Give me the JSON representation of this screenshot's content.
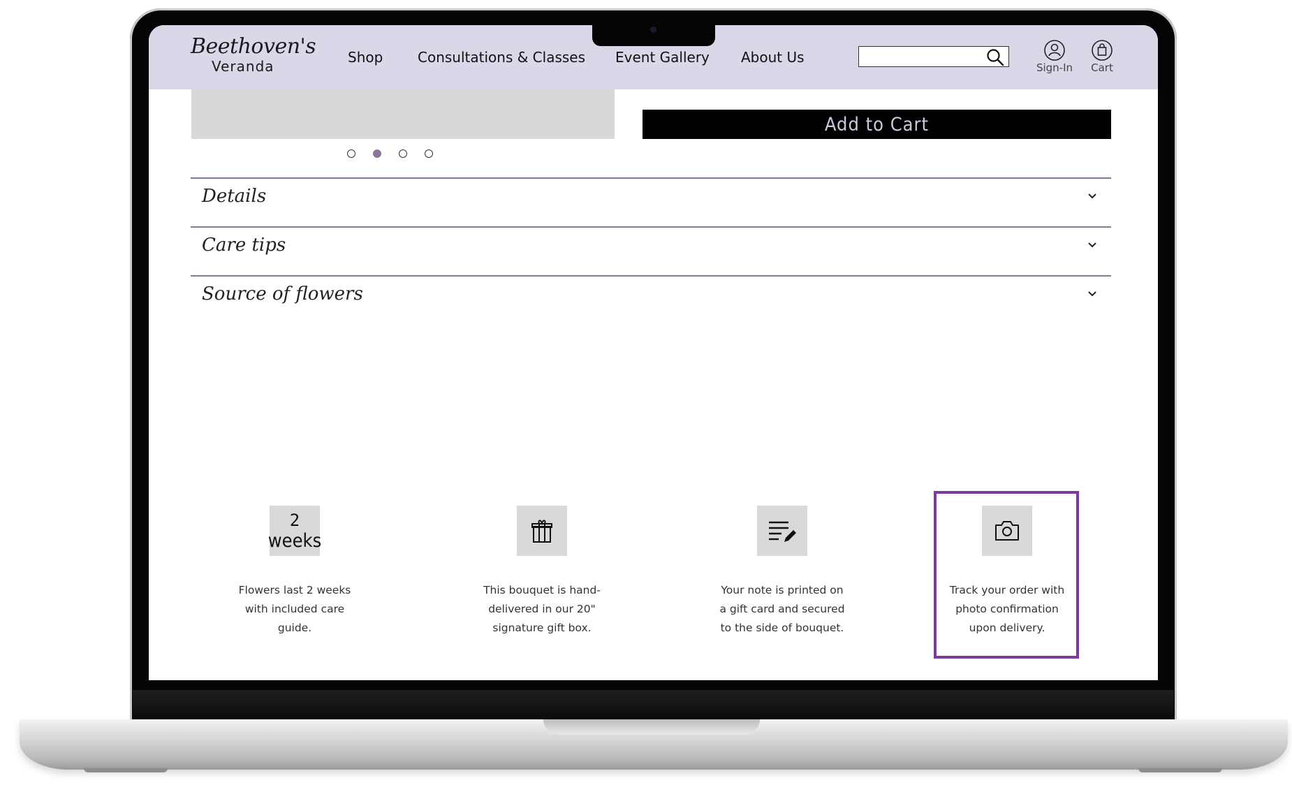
{
  "brand": {
    "logo_script": "Beethoven's",
    "logo_sub": "Veranda"
  },
  "nav": {
    "items": [
      "Shop",
      "Consultations & Classes",
      "Event Gallery",
      "About Us"
    ]
  },
  "search": {
    "value": "",
    "placeholder": ""
  },
  "account": {
    "signin_label": "Sign-In",
    "cart_label": "Cart"
  },
  "carousel": {
    "dot_count": 4,
    "active_index": 1
  },
  "product": {
    "add_to_cart_label": "Add to Cart"
  },
  "accordion": {
    "items": [
      "Details",
      "Care tips",
      "Source of flowers"
    ]
  },
  "features": [
    {
      "icon": "two-weeks-badge",
      "tile_num": "2",
      "tile_text": "weeks",
      "lines": [
        "Flowers last 2 weeks",
        "with included care",
        "guide."
      ]
    },
    {
      "icon": "gift-box-icon",
      "lines": [
        "This bouquet is hand-",
        "delivered in our 20\"",
        "signature gift box."
      ]
    },
    {
      "icon": "note-edit-icon",
      "lines": [
        "Your note is printed on",
        "a gift card and secured",
        "to the side of  bouquet."
      ]
    },
    {
      "icon": "camera-icon",
      "lines": [
        "Track your order with",
        "photo confirmation",
        "upon delivery."
      ]
    }
  ],
  "colors": {
    "header_bg": "#dbd7e8",
    "accent_purple": "#8c739a",
    "divider": "#8a7797",
    "highlight": "#7c3aa0",
    "button_bg": "#000000",
    "button_text": "#cfc6e0"
  }
}
